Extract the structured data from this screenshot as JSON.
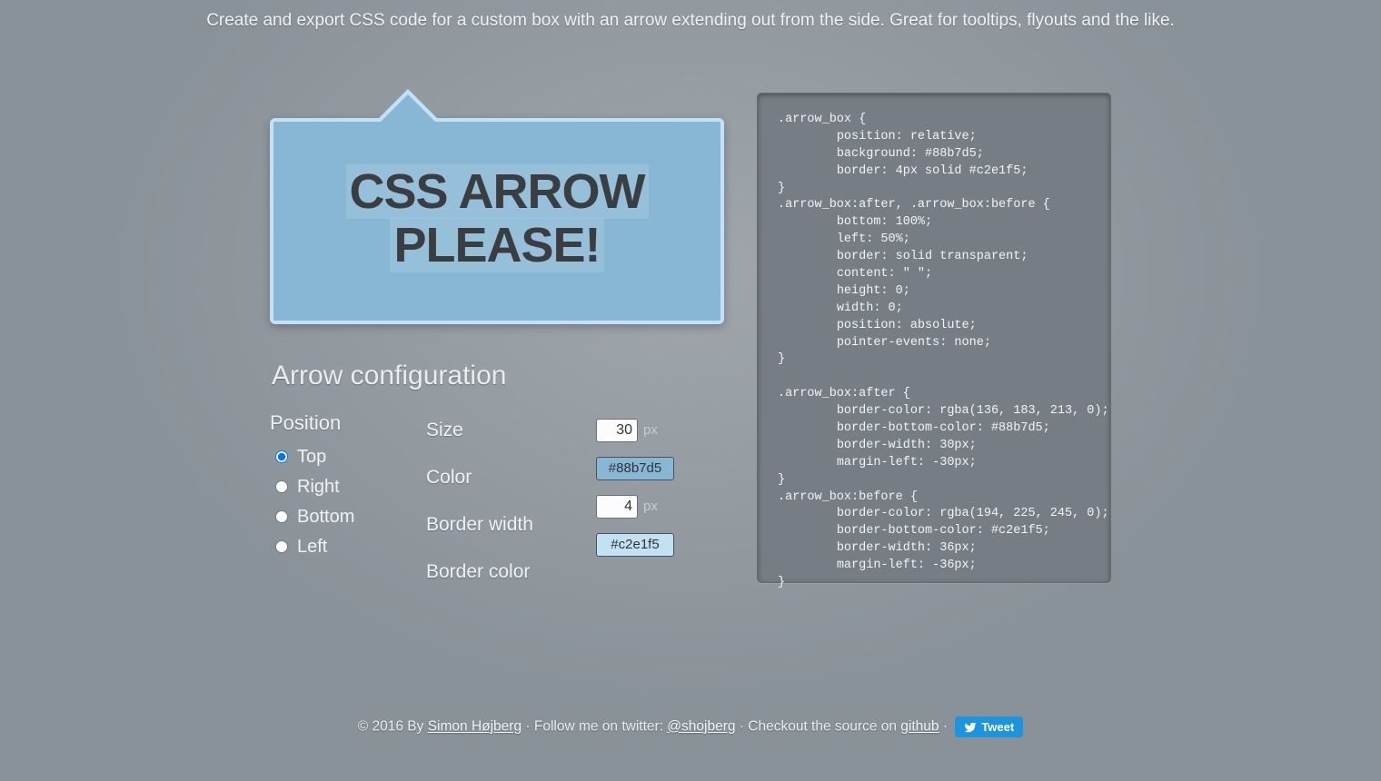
{
  "tagline": "Create and export CSS code for a custom box with an arrow extending out from the side. Great for tooltips, flyouts and the like.",
  "preview": {
    "title_line1": "CSS ARROW",
    "title_line2": "PLEASE!",
    "arrow_bg": "#88b7d5",
    "arrow_border": "#c2e1f5"
  },
  "config": {
    "heading": "Arrow configuration",
    "position_label": "Position",
    "positions": [
      {
        "label": "Top",
        "checked": true
      },
      {
        "label": "Right",
        "checked": false
      },
      {
        "label": "Bottom",
        "checked": false
      },
      {
        "label": "Left",
        "checked": false
      }
    ],
    "size_label": "Size",
    "size_value": "30",
    "color_label": "Color",
    "color_value": "#88b7d5",
    "border_width_label": "Border width",
    "border_width_value": "4",
    "border_color_label": "Border color",
    "border_color_value": "#c2e1f5",
    "px": "px"
  },
  "code": ".arrow_box {\n\tposition: relative;\n\tbackground: #88b7d5;\n\tborder: 4px solid #c2e1f5;\n}\n.arrow_box:after, .arrow_box:before {\n\tbottom: 100%;\n\tleft: 50%;\n\tborder: solid transparent;\n\tcontent: \" \";\n\theight: 0;\n\twidth: 0;\n\tposition: absolute;\n\tpointer-events: none;\n}\n\n.arrow_box:after {\n\tborder-color: rgba(136, 183, 213, 0);\n\tborder-bottom-color: #88b7d5;\n\tborder-width: 30px;\n\tmargin-left: -30px;\n}\n.arrow_box:before {\n\tborder-color: rgba(194, 225, 245, 0);\n\tborder-bottom-color: #c2e1f5;\n\tborder-width: 36px;\n\tmargin-left: -36px;\n}",
  "footer": {
    "copyright": "© 2016 By ",
    "author": "Simon Højberg",
    "follow": " · Follow me on twitter: ",
    "twitter_handle": "@shojberg",
    "source": " · Checkout the source on ",
    "github": "github",
    "dot": " · ",
    "tweet": "Tweet"
  }
}
